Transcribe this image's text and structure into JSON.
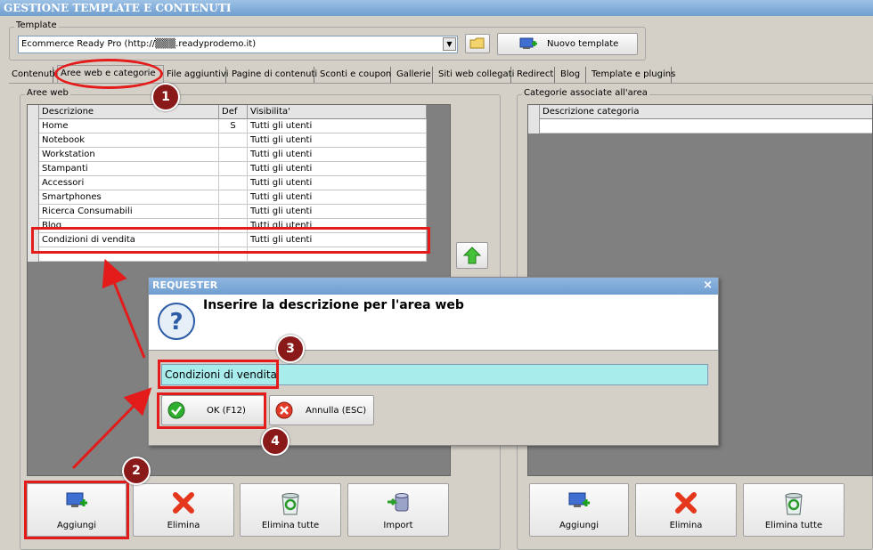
{
  "window": {
    "title": "GESTIONE TEMPLATE E CONTENUTI"
  },
  "template": {
    "group_label": "Template",
    "selected": "Ecommerce Ready Pro (http://▒▒▒.readyprodemo.it)",
    "new_template_label": "Nuovo template"
  },
  "tabs": [
    "Contenuti",
    "Aree web e categorie",
    "File aggiuntivi",
    "Pagine di contenuti",
    "Sconti e coupon",
    "Gallerie",
    "Siti web collegati",
    "Redirect",
    "Blog",
    "Template e plugins"
  ],
  "areas": {
    "group_label": "Aree web",
    "columns": [
      "Descrizione",
      "Def",
      "Visibilita'"
    ],
    "rows": [
      {
        "desc": "Home",
        "def": "S",
        "vis": "Tutti gli utenti"
      },
      {
        "desc": "Notebook",
        "def": "",
        "vis": "Tutti gli utenti"
      },
      {
        "desc": "Workstation",
        "def": "",
        "vis": "Tutti gli utenti"
      },
      {
        "desc": "Stampanti",
        "def": "",
        "vis": "Tutti gli utenti"
      },
      {
        "desc": "Accessori",
        "def": "",
        "vis": "Tutti gli utenti"
      },
      {
        "desc": "Smartphones",
        "def": "",
        "vis": "Tutti gli utenti"
      },
      {
        "desc": "Ricerca Consumabili",
        "def": "",
        "vis": "Tutti gli utenti"
      },
      {
        "desc": "Blog",
        "def": "",
        "vis": "Tutti gli utenti"
      },
      {
        "desc": "Condizioni di vendita",
        "def": "",
        "vis": "Tutti gli utenti"
      },
      {
        "desc": "",
        "def": "",
        "vis": ""
      }
    ],
    "buttons": {
      "add": "Aggiungi",
      "delete": "Elimina",
      "delete_all": "Elimina tutte",
      "import": "Import"
    }
  },
  "categories": {
    "group_label": "Categorie associate all'area",
    "column": "Descrizione categoria",
    "buttons": {
      "add": "Aggiungi",
      "delete": "Elimina",
      "delete_all": "Elimina tutte"
    }
  },
  "dialog": {
    "title": "REQUESTER",
    "close": "×",
    "prompt": "Inserire la descrizione per l'area web",
    "value": "Condizioni di vendita",
    "ok_label": "OK (F12)",
    "cancel_label": "Annulla (ESC)"
  },
  "annotations": [
    "1",
    "2",
    "3",
    "4"
  ],
  "colors": {
    "annotation_red": "#e31b1b",
    "badge": "#8a1a1a",
    "input_bg": "#a8ecec",
    "title_blue": "#6f9ed0"
  }
}
